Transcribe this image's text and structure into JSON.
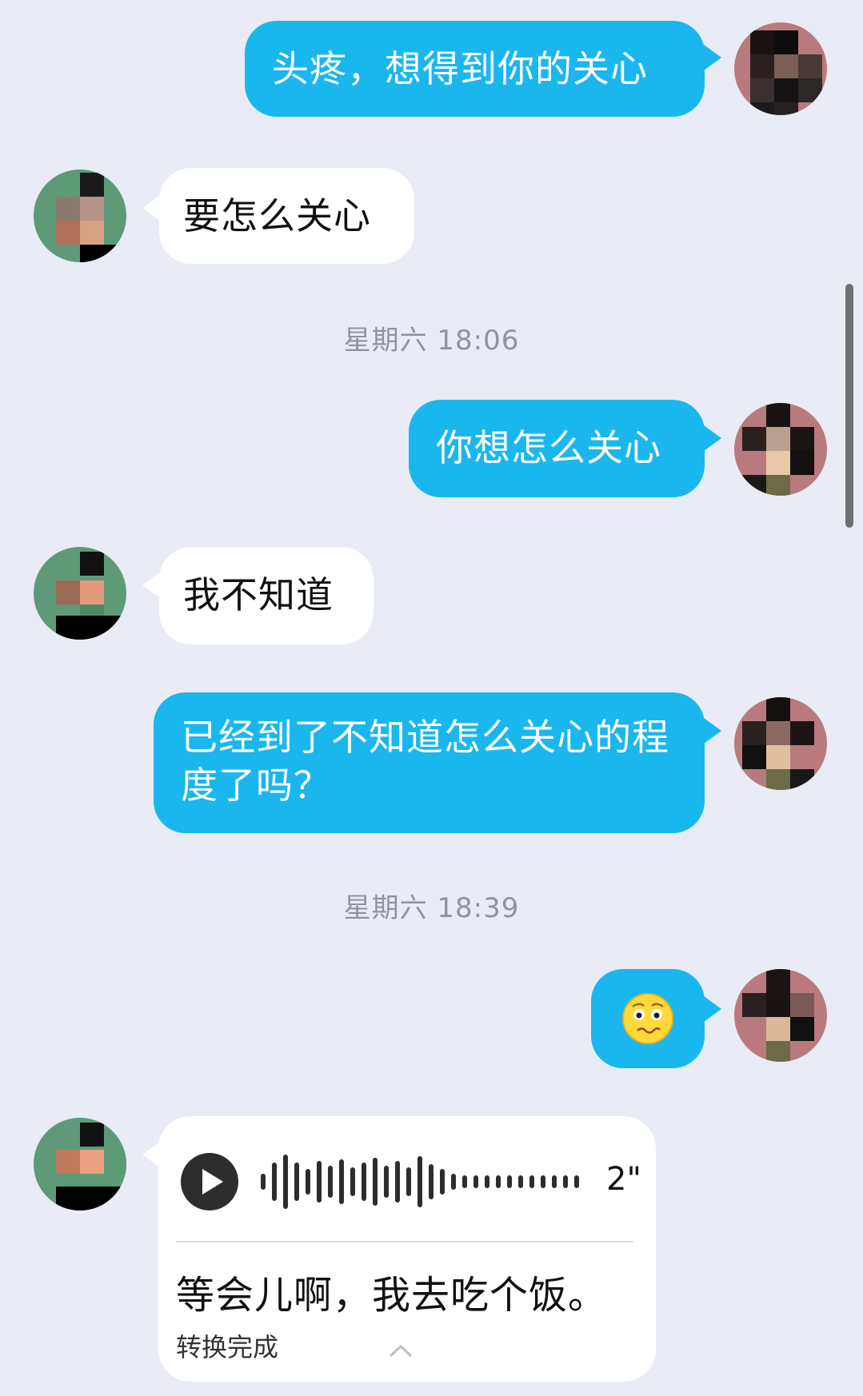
{
  "messages": {
    "m1": "头疼，想得到你的关心",
    "m2": "要怎么关心",
    "t1": "星期六 18:06",
    "m3": "你想怎么关心",
    "m4": "我不知道",
    "m5": "已经到了不知道怎么关心的程度了吗？",
    "t2": "星期六 18:39",
    "voice": {
      "duration": "2\"",
      "transcript": "等会儿啊，我去吃个饭。",
      "status": "转换完成"
    }
  },
  "colors": {
    "background": "#e9ecf5",
    "outgoing_bubble": "#1ab7ef",
    "incoming_bubble": "#ffffff",
    "timestamp": "#8f939c"
  },
  "icons": [
    "play-icon",
    "waveform-icon",
    "chevron-up-icon",
    "worried-emoji-icon"
  ]
}
